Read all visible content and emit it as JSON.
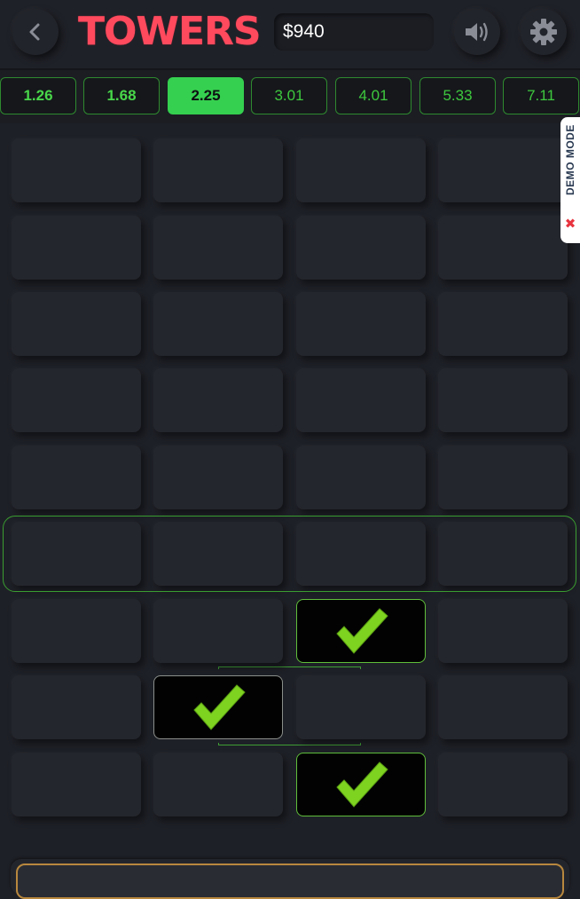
{
  "header": {
    "logo": "TOWERS",
    "balance": "$940",
    "back_icon": "chevron-left-icon",
    "sound_icon": "speaker-icon",
    "settings_icon": "gear-icon"
  },
  "multipliers": [
    {
      "label": "1.26",
      "state": "done"
    },
    {
      "label": "1.68",
      "state": "done"
    },
    {
      "label": "2.25",
      "state": "active"
    },
    {
      "label": "3.01",
      "state": "pending"
    },
    {
      "label": "4.01",
      "state": "pending"
    },
    {
      "label": "5.33",
      "state": "pending"
    },
    {
      "label": "7.11",
      "state": "pending"
    }
  ],
  "board": {
    "columns": 4,
    "rows": 9,
    "current_row_from_bottom": 4,
    "revealed": [
      {
        "row_from_bottom": 1,
        "column": 3,
        "icon": "check-icon"
      },
      {
        "row_from_bottom": 2,
        "column": 2,
        "icon": "check-icon"
      },
      {
        "row_from_bottom": 3,
        "column": 3,
        "icon": "check-icon"
      }
    ]
  },
  "demo_badge": {
    "label": "DEMO MODE",
    "icon": "close-icon"
  },
  "colors": {
    "background": "#1e2027",
    "logo": "#ff4a5e",
    "accent_green": "#35d04f",
    "check_green": "#7ed321",
    "demo_x": "#e8343f"
  }
}
